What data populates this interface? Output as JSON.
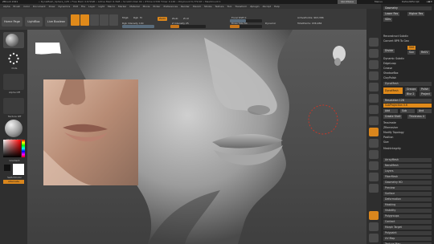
{
  "titlebar": {
    "app_title": "ZBrush 2021",
    "stats": "• DynaMesh_Sphere_128 • Free Mem 4.672GB • Active Mem 6.3GB • Scratch Disk 49 • ZTime 0.536 Timer 0.146 • PolyCount 6,779 KP • MeshCount 1",
    "quicksave_label": "QuickSave",
    "see_through": "See-through 0",
    "menus": "Menus",
    "default_script": "DefaultZScript"
  },
  "menubar": [
    "Alpha",
    "Brush",
    "Color",
    "Document",
    "Draw",
    "Dynamics",
    "Edit",
    "File",
    "Layer",
    "Light",
    "Macro",
    "Marker",
    "Material",
    "Movie",
    "Picker",
    "Preferences",
    "Render",
    "Stencil",
    "Stroke",
    "Texture",
    "Tool",
    "Transform",
    "Zplugin",
    "Zscript",
    "Help"
  ],
  "shelf": {
    "home_page": "Home Page",
    "lightbox": "LightBox",
    "live_boolean": "Live Boolean",
    "edit": "Edit",
    "draw": "Draw",
    "move": "Move",
    "scale": "Scale",
    "rotate": "Rotate",
    "mrgb": "Mrgb",
    "rgb": "Rgb",
    "m": "M",
    "rgb_intensity": "Rgb Intensity 100",
    "zadd": "Zadd",
    "zsub": "Zsub",
    "zcut": "Zcut",
    "z_intensity": "Z Intensity 25",
    "focal_shift": "Focal Shift 0",
    "draw_size": "Draw Size 64",
    "dynamic": "Dynamic",
    "active_points": "ActivePoints: 963,386",
    "total_points": "TotalPoints: 936,984"
  },
  "lefttray": {
    "brush_label": "Standard",
    "stroke_label": "Dots",
    "alpha_label": "Alpha Off",
    "texture_label": "Texture Off",
    "material_label": "MatCap Gray",
    "gradient_label": "Gradient",
    "switch_color": "SwitchColor",
    "alternate": "Alternate"
  },
  "palette": {
    "geometry": "Geometry",
    "lower_res": "Lower Res",
    "higher_res": "Higher Res",
    "sdiv": "SDiv",
    "reconstruct_subdiv": "Reconstruct Subdiv",
    "convert_bpr": "Convert BPR To Geo",
    "divide": "Divide",
    "smt": "Smt",
    "suv": "Suv",
    "reuv": "ReUV",
    "dynamic_subdiv": "Dynamic Subdiv",
    "edge_loop": "EdgeLoop",
    "crease": "Crease",
    "shadowbox": "ShadowBox",
    "claypolish": "ClayPolish",
    "dynamesh": "DynaMesh",
    "dynamesh_btn": "DynaMesh",
    "groups": "Groups",
    "polish": "Polish",
    "blur": "Blur 2",
    "project": "Project",
    "resolution": "Resolution 128",
    "subprojection": "SubProjection 0.6",
    "add": "Add",
    "sub": "Sub",
    "and": "And",
    "create_shell": "Create Shell",
    "thickness": "Thickness 4",
    "tessimate": "Tessimate",
    "zremesher": "ZRemesher",
    "modify_topology": "Modify Topology",
    "position": "Position",
    "size": "Size",
    "meshintegrity": "MeshIntegrity",
    "sections": [
      "ArrayMesh",
      "NanoMesh",
      "Layers",
      "FiberMesh",
      "Geometry HD",
      "Preview",
      "Surface",
      "Deformation",
      "Masking",
      "Visibility",
      "Polygroups",
      "Contact",
      "Morph Target",
      "Polypaint",
      "UV Map",
      "Texture Map"
    ]
  },
  "colors": {
    "accent": "#e08a1a",
    "panel": "#262626",
    "canvas": "#4e4e4e"
  }
}
